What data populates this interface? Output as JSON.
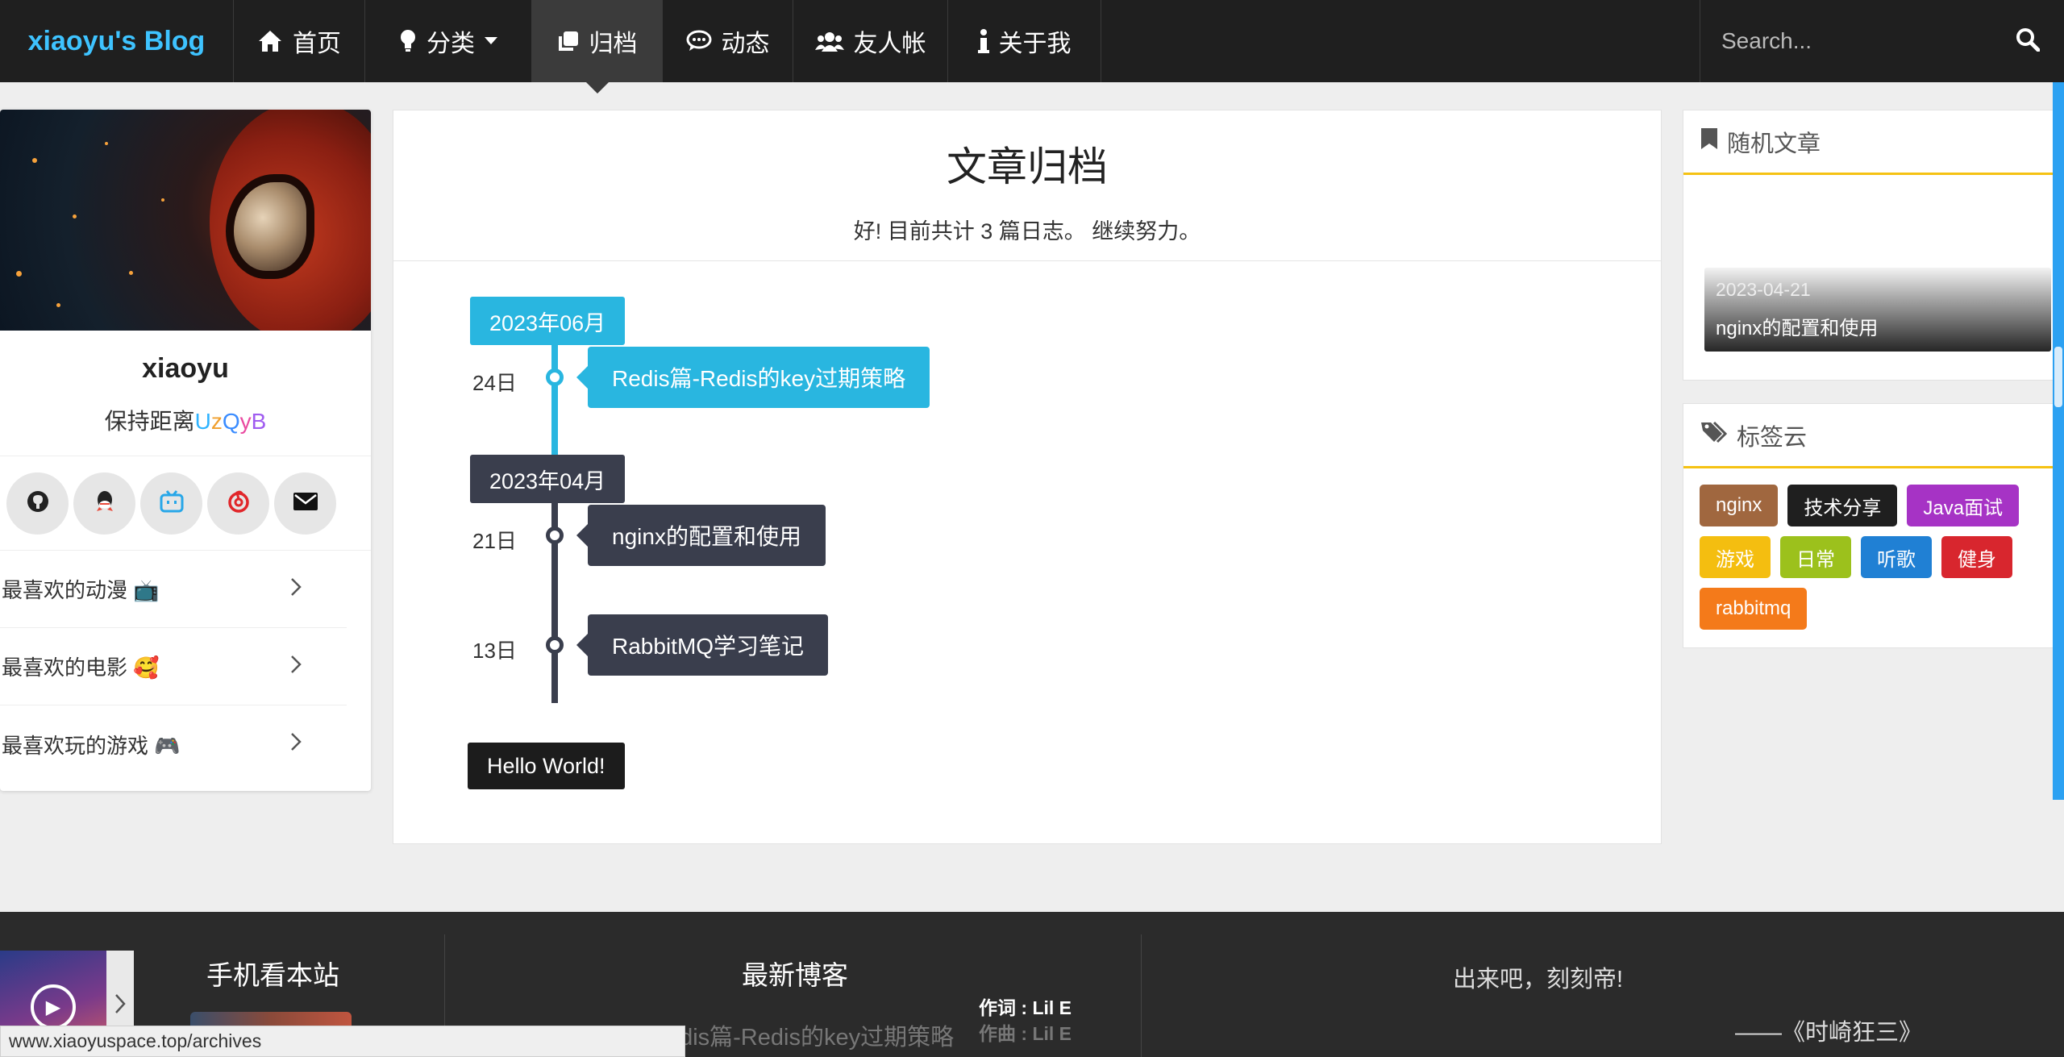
{
  "nav": {
    "brand": "xiaoyu's Blog",
    "items": [
      {
        "label": "首页",
        "icon": "home-icon"
      },
      {
        "label": "分类",
        "icon": "lightbulb-icon"
      },
      {
        "label": "归档",
        "icon": "archive-icon"
      },
      {
        "label": "动态",
        "icon": "chat-icon"
      },
      {
        "label": "友人帐",
        "icon": "users-icon"
      },
      {
        "label": "关于我",
        "icon": "info-icon"
      }
    ],
    "active": "归档",
    "search_placeholder": "Search..."
  },
  "profile": {
    "name": "xiaoyu",
    "motto_prefix": "保持距离",
    "motto_rainbow": [
      "U",
      "z",
      "Q",
      "y",
      "B"
    ],
    "social": [
      "github-icon",
      "qq-icon",
      "bilibili-icon",
      "netease-music-icon",
      "mail-icon"
    ],
    "favorites": [
      {
        "label": "最喜欢的动漫 📺"
      },
      {
        "label": "最喜欢的电影 🥰"
      },
      {
        "label": "最喜欢玩的游戏 🎮"
      }
    ]
  },
  "archive": {
    "title": "文章归档",
    "subtitle": "好! 目前共计 3 篇日志。 继续努力。",
    "months": [
      {
        "label": "2023年06月",
        "color": "#29b6e0"
      },
      {
        "label": "2023年04月",
        "color": "#3a3e4d"
      }
    ],
    "posts": [
      {
        "day": "24日",
        "title": "Redis篇-Redis的key过期策略",
        "color": "#29b6e0"
      },
      {
        "day": "21日",
        "title": "nginx的配置和使用",
        "color": "#3a3e4d"
      },
      {
        "day": "13日",
        "title": "RabbitMQ学习笔记",
        "color": "#3a3e4d"
      }
    ],
    "end_label": "Hello World!"
  },
  "sidebar": {
    "random_title": "随机文章",
    "random_post": {
      "date": "2023-04-21",
      "title": "nginx的配置和使用"
    },
    "tags_title": "标签云",
    "tags": [
      {
        "label": "nginx",
        "color": "#a0673f"
      },
      {
        "label": "技术分享",
        "color": "#1f1f1f"
      },
      {
        "label": "Java面试",
        "color": "#a633c5"
      },
      {
        "label": "游戏",
        "color": "#f4be10"
      },
      {
        "label": "日常",
        "color": "#9cc11c"
      },
      {
        "label": "听歌",
        "color": "#2080d4"
      },
      {
        "label": "健身",
        "color": "#d8262e"
      },
      {
        "label": "rabbitmq",
        "color": "#f47a1a"
      }
    ]
  },
  "footer": {
    "mobile_title": "手机看本站",
    "latest_title": "最新博客",
    "latest_post": "Redis篇-Redis的key过期策略",
    "lyric_1": "作词 : Lil E",
    "lyric_2": "作曲 : Lil E",
    "quote": "出来吧，刻刻帝!",
    "quote_source": "——《时崎狂三》"
  },
  "status_url": "www.xiaoyuspace.top/archives"
}
